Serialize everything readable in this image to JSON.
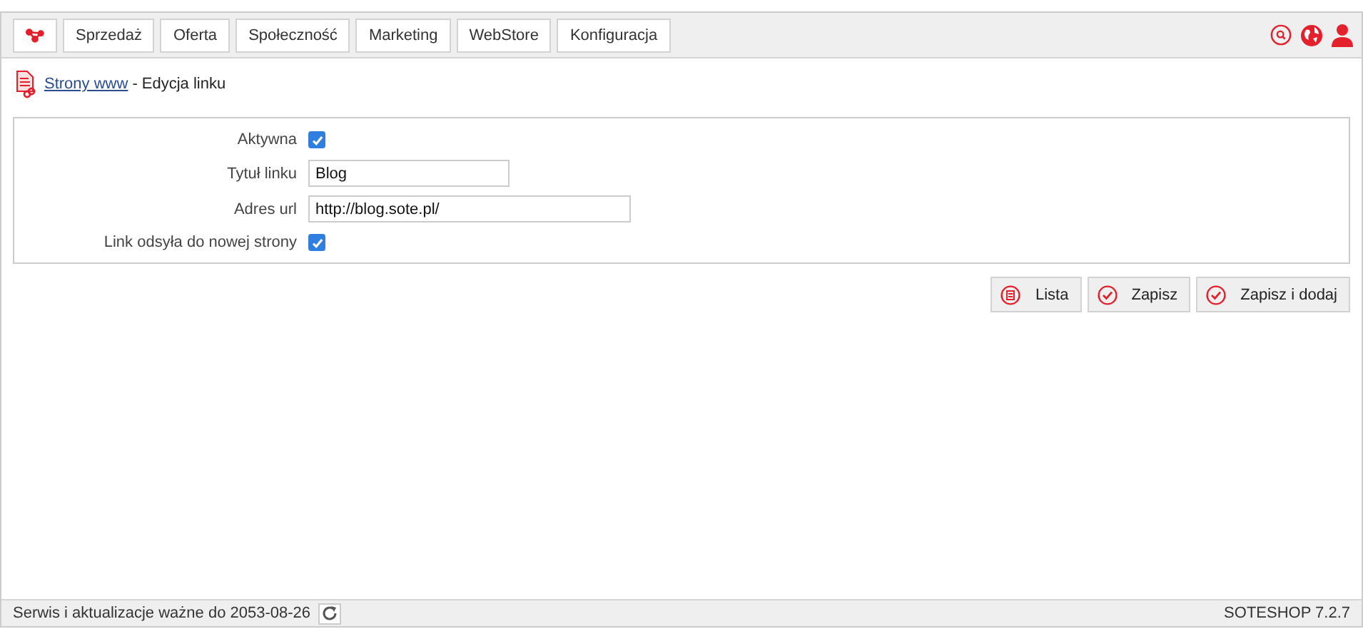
{
  "menu": [
    {
      "label": "Sprzedaż"
    },
    {
      "label": "Oferta"
    },
    {
      "label": "Społeczność"
    },
    {
      "label": "Marketing"
    },
    {
      "label": "WebStore"
    },
    {
      "label": "Konfiguracja"
    }
  ],
  "breadcrumb": {
    "link": "Strony www",
    "title": "- Edycja linku"
  },
  "form": [
    {
      "kind": "checkbox",
      "label": "Aktywna",
      "checked": true
    },
    {
      "kind": "text",
      "label": "Tytuł linku",
      "value": "Blog",
      "wide": false
    },
    {
      "kind": "text",
      "label": "Adres url",
      "value": "http://blog.sote.pl/",
      "wide": true
    },
    {
      "kind": "checkbox",
      "label": "Link odsyła do nowej strony",
      "checked": true
    }
  ],
  "buttons": [
    {
      "kind": "list",
      "label": "Lista"
    },
    {
      "kind": "save",
      "label": "Zapisz"
    },
    {
      "kind": "save",
      "label": "Zapisz i dodaj"
    }
  ],
  "status_bar": {
    "left": "Serwis i aktualizacje ważne do 2053-08-26",
    "right": "SOTESHOP 7.2.7"
  }
}
